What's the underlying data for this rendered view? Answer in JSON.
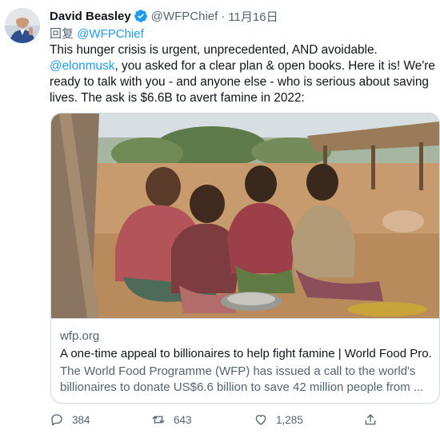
{
  "tweet": {
    "author_name": "David Beasley",
    "handle": "@WFPChief",
    "separator": "·",
    "date": "11月16日",
    "reply_label": "回复",
    "reply_to": "@WFPChief",
    "text_part1": "This hunger crisis is urgent, unprecedented, AND avoidable. ",
    "text_mention": "@elonmusk",
    "text_part2": ", you asked for a clear plan & open books. Here it is! We're ready to talk with you - and anyone else - who is serious about saving lives. The ask is $6.6B to avert famine in 2022:"
  },
  "card": {
    "domain": "wfp.org",
    "title": "A one-time appeal to billionaires to help fight famine | World Food Pro...",
    "description": "The World Food Programme (WFP) has issued a call to the world's billionaires to donate US$6.6 billion to save 42 million people from ..."
  },
  "actions": {
    "reply_count": "384",
    "retweet_count": "643",
    "like_count": "1,285"
  },
  "icons": {
    "verified": "verified-badge-icon",
    "reply": "reply-icon",
    "retweet": "retweet-icon",
    "like": "like-icon",
    "share": "share-icon"
  },
  "colors": {
    "accent": "#1d9bf0",
    "secondary_text": "#536471",
    "border": "#cfd9de"
  }
}
